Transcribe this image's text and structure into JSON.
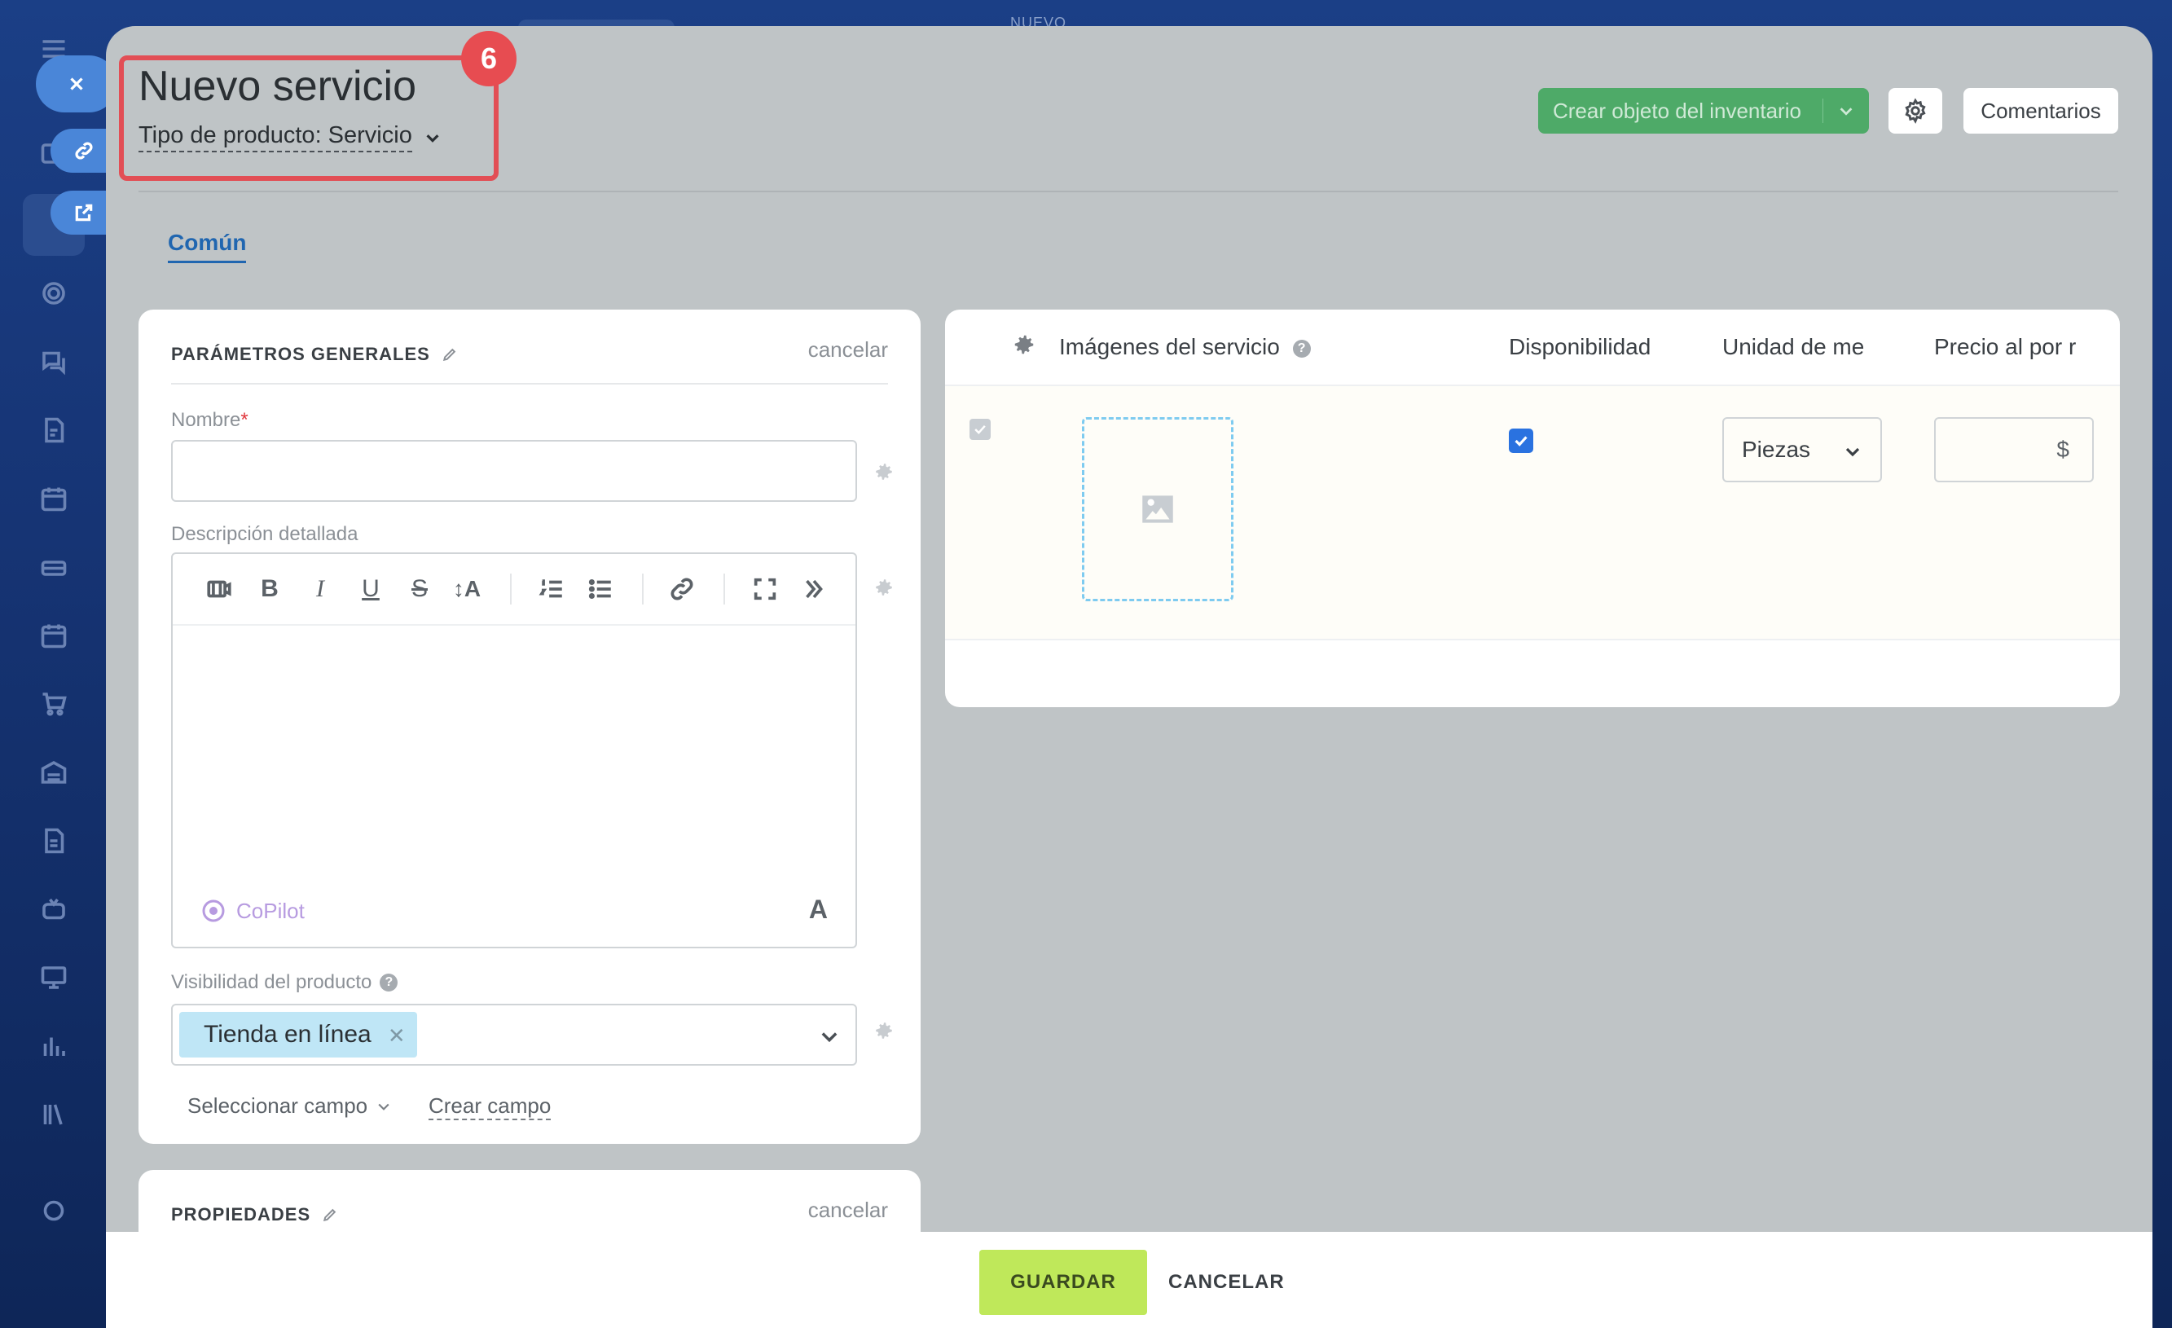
{
  "header": {
    "title": "Nuevo servicio",
    "product_type": "Tipo de producto: Servicio",
    "step_badge": "6",
    "top_label": "NUEVO",
    "create_inventory_label": "Crear objeto del inventario",
    "comments_label": "Comentarios"
  },
  "tabs": [
    {
      "label": "Común"
    }
  ],
  "general": {
    "title": "PARÁMETROS GENERALES",
    "cancel": "cancelar",
    "name_label": "Nombre",
    "required_mark": "*",
    "name_value": "",
    "description_label": "Descripción detallada",
    "copilot_label": "CoPilot",
    "font_button": "A",
    "visibility_label": "Visibilidad del producto",
    "visibility_chip": "Tienda en línea",
    "select_field": "Seleccionar campo",
    "create_field": "Crear campo"
  },
  "properties": {
    "title": "PROPIEDADES",
    "cancel": "cancelar"
  },
  "images_table": {
    "columns": [
      "Imágenes del servicio",
      "Disponibilidad",
      "Unidad de me",
      "Precio al por r"
    ],
    "row": {
      "available": true,
      "unit": "Piezas",
      "price": "",
      "currency": "$"
    }
  },
  "footer": {
    "save": "GUARDAR",
    "cancel": "CANCELAR"
  },
  "colors": {
    "accent_blue": "#2066b0",
    "create_green": "#4eaa68",
    "save_lime": "#bfe85a",
    "highlight_red": "#e24e55"
  }
}
